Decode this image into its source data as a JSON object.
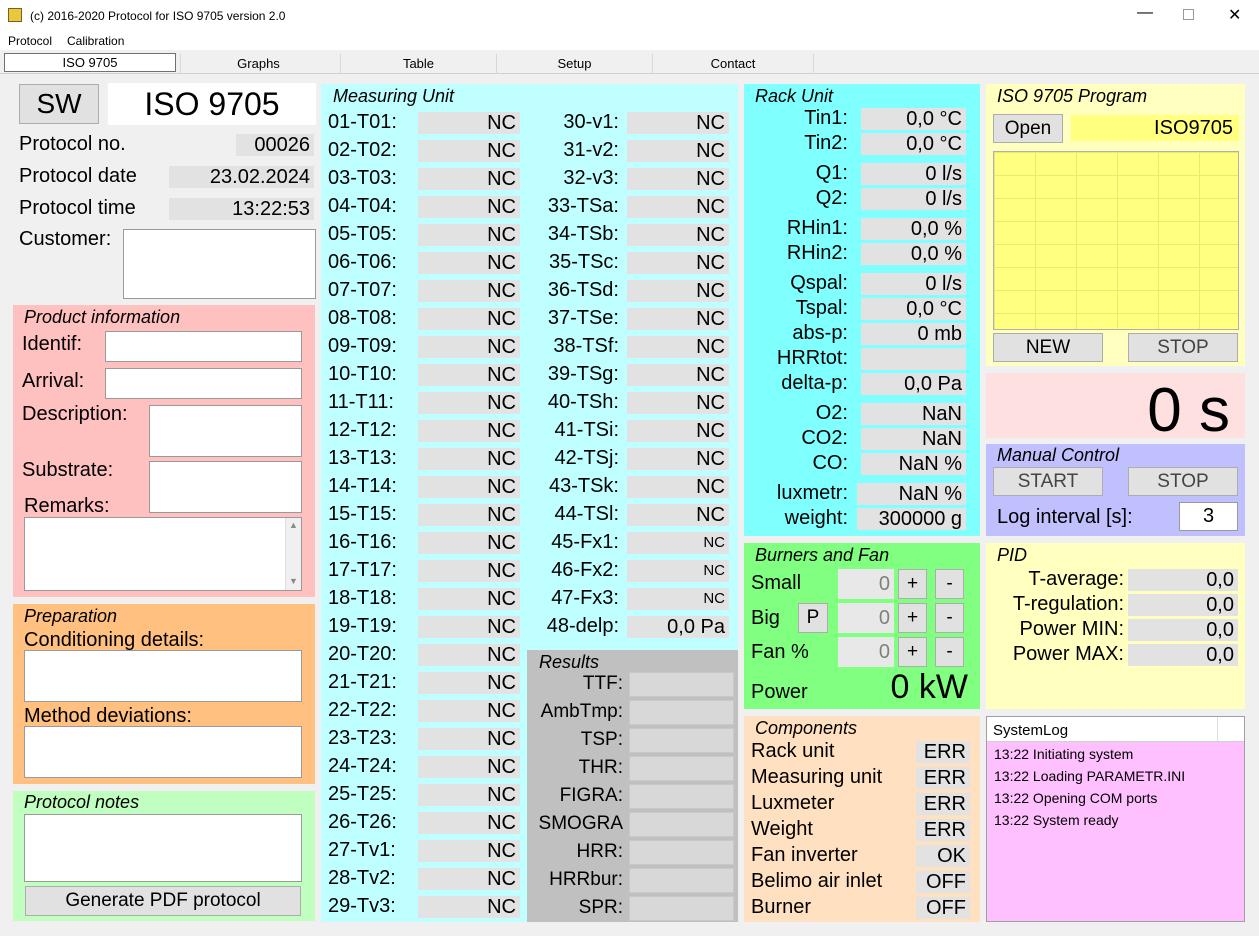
{
  "window": {
    "title": "(c) 2016-2020 Protocol for ISO 9705 version 2.0"
  },
  "menu": [
    "Protocol",
    "Calibration"
  ],
  "tabs": [
    "ISO 9705",
    "Graphs",
    "Table",
    "Setup",
    "Contact"
  ],
  "header": {
    "sw_label": "SW",
    "standard": "ISO 9705"
  },
  "protocol": {
    "no_label": "Protocol no.",
    "no": "00026",
    "date_label": "Protocol date",
    "date": "23.02.2024",
    "time_label": "Protocol time",
    "time": "13:22:53",
    "customer_label": "Customer:"
  },
  "product": {
    "title": "Product information",
    "identif": "Identif:",
    "arrival": "Arrival:",
    "description": "Description:",
    "substrate": "Substrate:",
    "remarks": "Remarks:"
  },
  "preparation": {
    "title": "Preparation",
    "conditioning": "Conditioning details:",
    "deviations": "Method deviations:"
  },
  "notes": {
    "title": "Protocol notes",
    "generate": "Generate PDF protocol"
  },
  "measuring": {
    "title": "Measuring Unit",
    "left": [
      {
        "l": "01-T01:",
        "v": "NC"
      },
      {
        "l": "02-T02:",
        "v": "NC"
      },
      {
        "l": "03-T03:",
        "v": "NC"
      },
      {
        "l": "04-T04:",
        "v": "NC"
      },
      {
        "l": "05-T05:",
        "v": "NC"
      },
      {
        "l": "06-T06:",
        "v": "NC"
      },
      {
        "l": "07-T07:",
        "v": "NC"
      },
      {
        "l": "08-T08:",
        "v": "NC"
      },
      {
        "l": "09-T09:",
        "v": "NC"
      },
      {
        "l": "10-T10:",
        "v": "NC"
      },
      {
        "l": "11-T11:",
        "v": "NC"
      },
      {
        "l": "12-T12:",
        "v": "NC"
      },
      {
        "l": "13-T13:",
        "v": "NC"
      },
      {
        "l": "14-T14:",
        "v": "NC"
      },
      {
        "l": "15-T15:",
        "v": "NC"
      },
      {
        "l": "16-T16:",
        "v": "NC"
      },
      {
        "l": "17-T17:",
        "v": "NC"
      },
      {
        "l": "18-T18:",
        "v": "NC"
      },
      {
        "l": "19-T19:",
        "v": "NC"
      },
      {
        "l": "20-T20:",
        "v": "NC"
      },
      {
        "l": "21-T21:",
        "v": "NC"
      },
      {
        "l": "22-T22:",
        "v": "NC"
      },
      {
        "l": "23-T23:",
        "v": "NC"
      },
      {
        "l": "24-T24:",
        "v": "NC"
      },
      {
        "l": "25-T25:",
        "v": "NC"
      },
      {
        "l": "26-T26:",
        "v": "NC"
      },
      {
        "l": "27-Tv1:",
        "v": "NC"
      },
      {
        "l": "28-Tv2:",
        "v": "NC"
      },
      {
        "l": "29-Tv3:",
        "v": "NC"
      }
    ],
    "right": [
      {
        "l": "30-v1:",
        "v": "NC"
      },
      {
        "l": "31-v2:",
        "v": "NC"
      },
      {
        "l": "32-v3:",
        "v": "NC"
      },
      {
        "l": "33-TSa:",
        "v": "NC"
      },
      {
        "l": "34-TSb:",
        "v": "NC"
      },
      {
        "l": "35-TSc:",
        "v": "NC"
      },
      {
        "l": "36-TSd:",
        "v": "NC"
      },
      {
        "l": "37-TSe:",
        "v": "NC"
      },
      {
        "l": "38-TSf:",
        "v": "NC"
      },
      {
        "l": "39-TSg:",
        "v": "NC"
      },
      {
        "l": "40-TSh:",
        "v": "NC"
      },
      {
        "l": "41-TSi:",
        "v": "NC"
      },
      {
        "l": "42-TSj:",
        "v": "NC"
      },
      {
        "l": "43-TSk:",
        "v": "NC"
      },
      {
        "l": "44-TSl:",
        "v": "NC"
      },
      {
        "l": "45-Fx1:",
        "v": "NC"
      },
      {
        "l": "46-Fx2:",
        "v": "NC"
      },
      {
        "l": "47-Fx3:",
        "v": "NC"
      },
      {
        "l": "48-delp:",
        "v": "0,0 Pa"
      }
    ]
  },
  "results": {
    "title": "Results",
    "items": [
      "TTF:",
      "AmbTmp:",
      "TSP:",
      "THR:",
      "FIGRA:",
      "SMOGRA",
      "HRR:",
      "HRRbur:",
      "SPR:"
    ]
  },
  "rack": {
    "title": "Rack Unit",
    "items": [
      {
        "l": "Tin1:",
        "v": "0,0 °C"
      },
      {
        "l": "Tin2:",
        "v": "0,0 °C"
      },
      {
        "l": "Q1:",
        "v": "0 l/s"
      },
      {
        "l": "Q2:",
        "v": "0 l/s"
      },
      {
        "l": "RHin1:",
        "v": "0,0 %"
      },
      {
        "l": "RHin2:",
        "v": "0,0 %"
      },
      {
        "l": "Qspal:",
        "v": "0 l/s"
      },
      {
        "l": "Tspal:",
        "v": "0,0 °C"
      },
      {
        "l": "abs-p:",
        "v": "0 mb"
      },
      {
        "l": "HRRtot:",
        "v": ""
      },
      {
        "l": "delta-p:",
        "v": "0,0 Pa"
      },
      {
        "l": "O2:",
        "v": "NaN"
      },
      {
        "l": "CO2:",
        "v": "NaN"
      },
      {
        "l": "CO:",
        "v": "NaN %"
      },
      {
        "l": "luxmetr:",
        "v": "NaN %"
      },
      {
        "l": "weight:",
        "v": "300000 g"
      }
    ]
  },
  "burners": {
    "title": "Burners and Fan",
    "small": "Small",
    "big": "Big",
    "fan": "Fan %",
    "p": "P",
    "small_v": "0",
    "big_v": "0",
    "fan_v": "0",
    "plus": "+",
    "minus": "-",
    "power_label": "Power",
    "power": "0 kW"
  },
  "components": {
    "title": "Components",
    "items": [
      {
        "l": "Rack unit",
        "v": "ERR"
      },
      {
        "l": "Measuring unit",
        "v": "ERR"
      },
      {
        "l": "Luxmeter",
        "v": "ERR"
      },
      {
        "l": "Weight",
        "v": "ERR"
      },
      {
        "l": "Fan inverter",
        "v": "OK"
      },
      {
        "l": "Belimo air inlet",
        "v": "OFF"
      },
      {
        "l": "Burner",
        "v": "OFF"
      }
    ]
  },
  "program": {
    "title": "ISO 9705 Program",
    "open": "Open",
    "name": "ISO9705",
    "new": "NEW",
    "stop": "STOP"
  },
  "timer": {
    "value": "0 s"
  },
  "manual": {
    "title": "Manual Control",
    "start": "START",
    "stop": "STOP",
    "log_label": "Log interval [s]:",
    "log_value": "3"
  },
  "pid": {
    "title": "PID",
    "items": [
      {
        "l": "T-average:",
        "v": "0,0"
      },
      {
        "l": "T-regulation:",
        "v": "0,0"
      },
      {
        "l": "Power MIN:",
        "v": "0,0"
      },
      {
        "l": "Power MAX:",
        "v": "0,0"
      }
    ]
  },
  "syslog": {
    "title": "SystemLog",
    "lines": [
      "13:22 Initiating system",
      "13:22 Loading PARAMETR.INI",
      "13:22 Opening COM ports",
      "13:22 System ready"
    ]
  },
  "colors": {
    "product": "#ffc0c0",
    "preparation": "#ffc080",
    "notes": "#c0ffc0",
    "measuring": "#c0ffff",
    "rack": "#80ffff",
    "burners": "#80ff80",
    "components": "#ffe0c0",
    "program": "#ffffc0",
    "timer": "#ffe0e0",
    "manual": "#c0c0ff",
    "pid": "#ffffc0",
    "syslog": "#ffc0ff"
  }
}
